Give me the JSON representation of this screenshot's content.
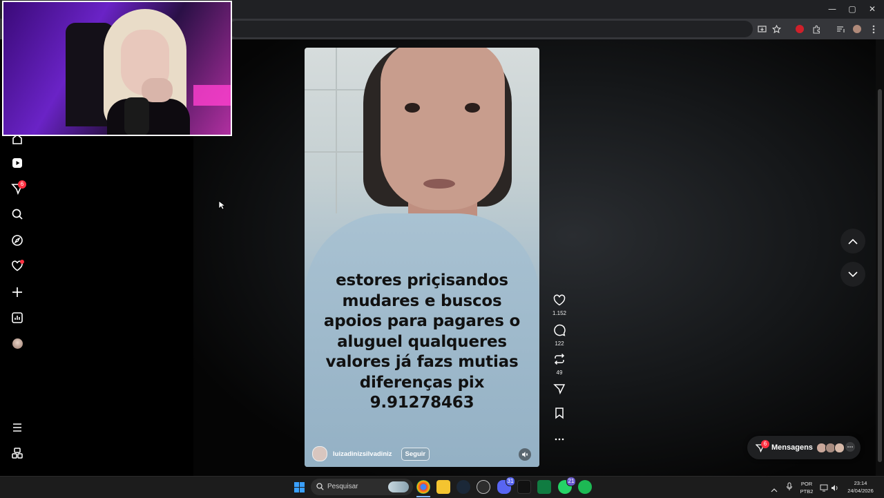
{
  "window": {
    "minimize": "—",
    "maximize": "▢",
    "close": "✕"
  },
  "sidebar": {
    "notifications_badge": "6",
    "icons": [
      "home-icon",
      "reels-icon",
      "direct-icon",
      "search-icon",
      "explore-icon",
      "heart-icon",
      "create-icon",
      "dashboard-icon",
      "profile-icon",
      "menu-icon",
      "also-from-meta-icon"
    ]
  },
  "video": {
    "caption": "estores priçisandos\nmudares e buscos\napoios  para pagares o\naluguel  qualqueres\nvalores  já  fazs mutias\ndiferenças  pix\n9.91278463",
    "username": "luizadinizsilvadiniz",
    "follow_label": "Seguir"
  },
  "actions": {
    "likes": "1.152",
    "comments": "122",
    "reposts": "49"
  },
  "messages": {
    "label": "Mensagens",
    "badge": "6"
  },
  "taskbar": {
    "search_placeholder": "Pesquisar",
    "discord_badge": "31",
    "whatsapp_badge": "21",
    "lang_top": "POR",
    "lang_bottom": "PTB2",
    "time": "23:14",
    "date": "24/04/2026"
  },
  "colors": {
    "accent_red": "#ff3040",
    "page_bg": "#000000"
  }
}
